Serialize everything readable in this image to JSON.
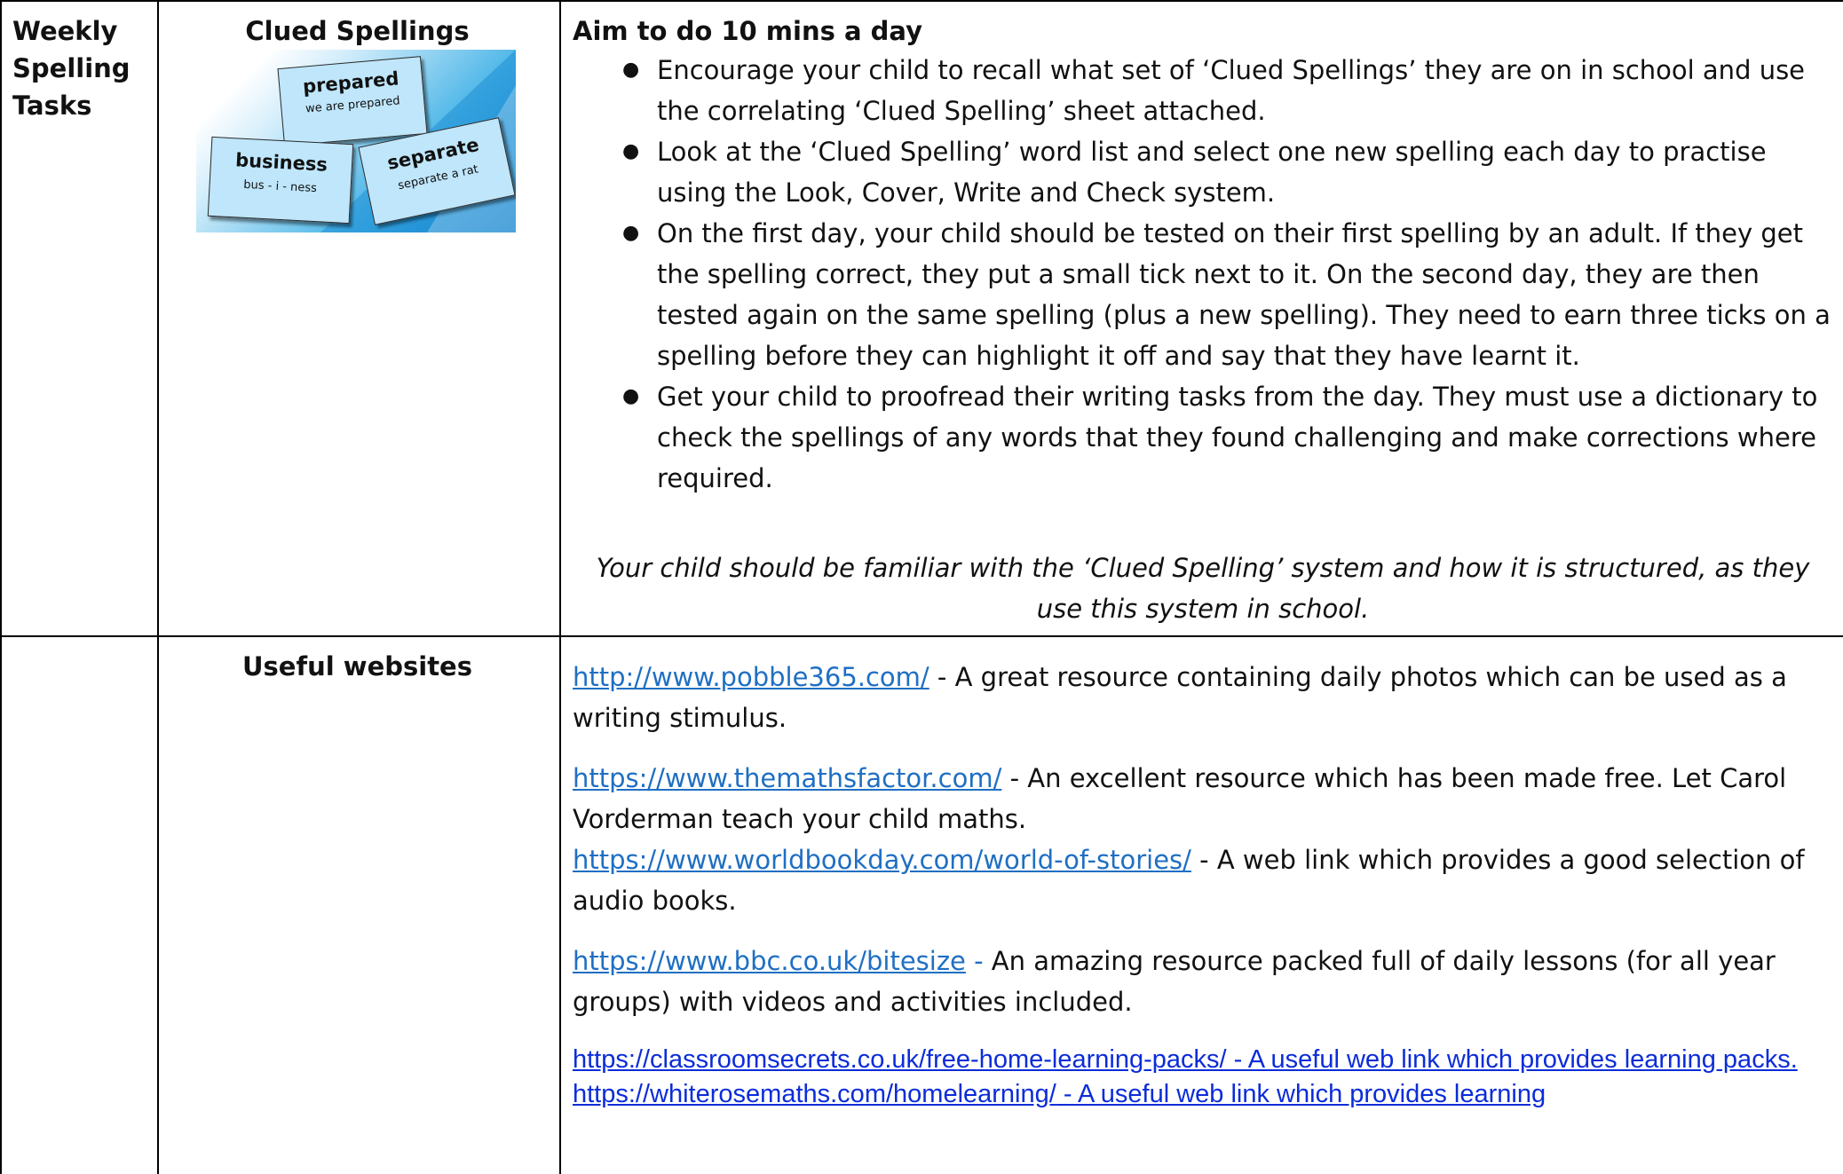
{
  "row1": {
    "col1_title": "Weekly Spelling Tasks",
    "col2_title": "Clued Spellings",
    "cards": [
      {
        "word": "prepared",
        "clue": "we are prepared"
      },
      {
        "word": "business",
        "clue": "bus - i - ness"
      },
      {
        "word": "separate",
        "clue": "separate a rat"
      }
    ],
    "aim": "Aim to do 10 mins a day",
    "bullets": [
      "Encourage your child to recall what set of ‘Clued Spellings’ they are on in school and use the correlating ‘Clued Spelling’ sheet attached.",
      "Look at the ‘Clued Spelling’ word list and select one new spelling each day to practise using the Look, Cover, Write and Check system.",
      "On the first day, your child should be tested on their first spelling by an adult. If they get the spelling correct, they put a small tick next to it. On the second day, they are then tested again on the same spelling (plus a new spelling). They need to earn three ticks on a spelling before they can highlight it off and say that they have learnt it.",
      "Get your child to proofread their writing tasks from the day. They must use a dictionary to check the spellings of any words that they found challenging and make corrections where required."
    ],
    "note": "Your child should be familiar with the ‘Clued Spelling’ system and how it is structured, as they use this system in school."
  },
  "row2": {
    "col2_title": "Useful websites",
    "sites": [
      {
        "url": "http://www.pobble365.com/",
        "desc": " - A great resource containing daily photos which can be used as a writing stimulus."
      },
      {
        "url": "https://www.themathsfactor.com/",
        "desc": " - An excellent resource which has been made free. Let Carol Vorderman teach your child maths."
      },
      {
        "url": "https://www.worldbookday.com/world-of-stories/",
        "desc": " - A web link which provides a good selection of audio books."
      },
      {
        "url": "https://www.bbc.co.uk/bitesize",
        "sep": " - ",
        "desc": "An amazing resource packed full of daily lessons (for all year groups) with videos and activities included."
      },
      {
        "url": "https://classroomsecrets.co.uk/free-home-learning-packs/",
        "desc": " - A useful web link which provides learning packs."
      },
      {
        "url": "https://whiterosemaths.com/homelearning/",
        "desc": " - A useful web link which provides learning"
      }
    ]
  },
  "colors": {
    "link": "#1f6fc3",
    "link_alt": "#0b2cd9",
    "bitesize_sep": "#1f6fc3"
  }
}
